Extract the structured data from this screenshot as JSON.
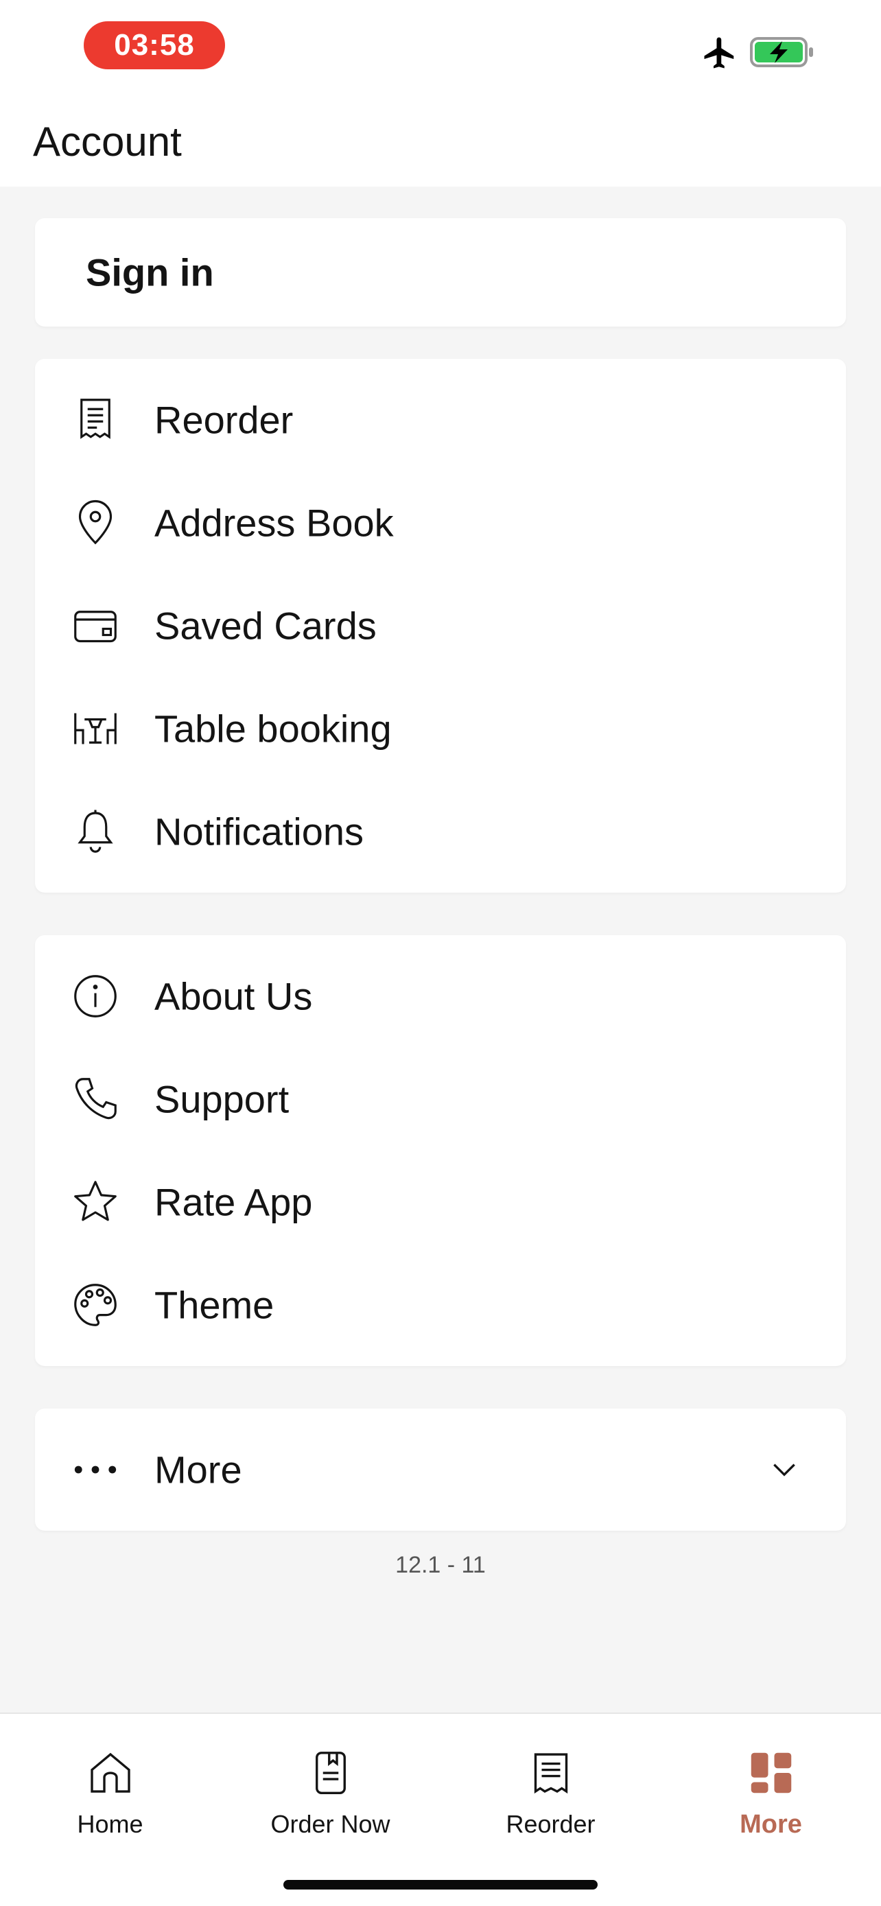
{
  "status_bar": {
    "time": "03:58"
  },
  "header": {
    "title": "Account"
  },
  "signin": {
    "label": "Sign in"
  },
  "menu_group_1": [
    {
      "label": "Reorder",
      "icon": "receipt-icon"
    },
    {
      "label": "Address Book",
      "icon": "location-pin-icon"
    },
    {
      "label": "Saved Cards",
      "icon": "credit-card-icon"
    },
    {
      "label": "Table booking",
      "icon": "table-chairs-icon"
    },
    {
      "label": "Notifications",
      "icon": "bell-icon"
    }
  ],
  "menu_group_2": [
    {
      "label": "About Us",
      "icon": "info-icon"
    },
    {
      "label": "Support",
      "icon": "phone-icon"
    },
    {
      "label": "Rate App",
      "icon": "star-icon"
    },
    {
      "label": "Theme",
      "icon": "palette-icon"
    }
  ],
  "more": {
    "label": "More",
    "icon": "ellipsis-icon"
  },
  "version": "12.1 - 11",
  "tabs": [
    {
      "label": "Home",
      "icon": "home-icon",
      "active": false
    },
    {
      "label": "Order Now",
      "icon": "menu-book-icon",
      "active": false
    },
    {
      "label": "Reorder",
      "icon": "receipt-icon",
      "active": false
    },
    {
      "label": "More",
      "icon": "grid-icon",
      "active": true
    }
  ],
  "colors": {
    "accent": "#b86a55",
    "status_time_bg": "#ec3a2f",
    "battery_green": "#34c759"
  }
}
